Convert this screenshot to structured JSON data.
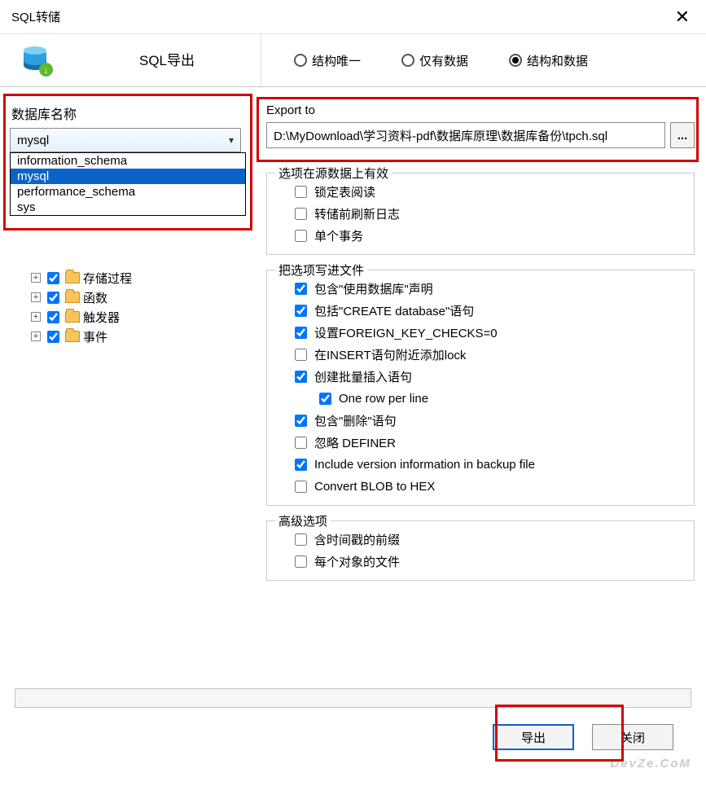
{
  "window": {
    "title": "SQL转储"
  },
  "toolbar": {
    "export_tab": "SQL导出"
  },
  "radios": {
    "structure_only": "结构唯一",
    "data_only": "仅有数据",
    "structure_and_data": "结构和数据",
    "selected": "structure_and_data"
  },
  "db": {
    "label": "数据库名称",
    "value": "mysql",
    "options": [
      "information_schema",
      "mysql",
      "performance_schema",
      "sys"
    ]
  },
  "tree": {
    "items": [
      {
        "label": "存储过程",
        "checked": true
      },
      {
        "label": "函数",
        "checked": true
      },
      {
        "label": "触发器",
        "checked": true
      },
      {
        "label": "事件",
        "checked": true
      }
    ]
  },
  "export": {
    "label": "Export to",
    "path": "D:\\MyDownload\\学习资料-pdf\\数据库原理\\数据库备份\\tpch.sql",
    "browse": "..."
  },
  "opts_source": {
    "legend": "选项在源数据上有效",
    "lock_tables": {
      "label": "锁定表阅读",
      "checked": false
    },
    "flush_logs": {
      "label": "转储前刷新日志",
      "checked": false
    },
    "single_tx": {
      "label": "单个事务",
      "checked": false
    }
  },
  "opts_file": {
    "legend": "把选项写进文件",
    "include_use_db": {
      "label": "包含\"使用数据库\"声明",
      "checked": true
    },
    "include_create_db": {
      "label": "包括\"CREATE database\"语句",
      "checked": true
    },
    "set_fk_checks": {
      "label": "设置FOREIGN_KEY_CHECKS=0",
      "checked": true
    },
    "lock_around_insert": {
      "label": "在INSERT语句附近添加lock",
      "checked": false
    },
    "bulk_insert": {
      "label": "创建批量插入语句",
      "checked": true
    },
    "one_row_per_line": {
      "label": "One row per line",
      "checked": true
    },
    "include_drop": {
      "label": "包含\"删除\"语句",
      "checked": true
    },
    "ignore_definer": {
      "label": "忽略 DEFINER",
      "checked": false
    },
    "include_version": {
      "label": "Include version information in backup file",
      "checked": true
    },
    "blob_to_hex": {
      "label": "Convert BLOB to HEX",
      "checked": false
    }
  },
  "opts_adv": {
    "legend": "高级选项",
    "timestamp_prefix": {
      "label": "含时间戳的前缀",
      "checked": false
    },
    "file_per_object": {
      "label": "每个对象的文件",
      "checked": false
    }
  },
  "buttons": {
    "export": "导出",
    "close": "关闭"
  },
  "watermark": "DevZe.CoM"
}
